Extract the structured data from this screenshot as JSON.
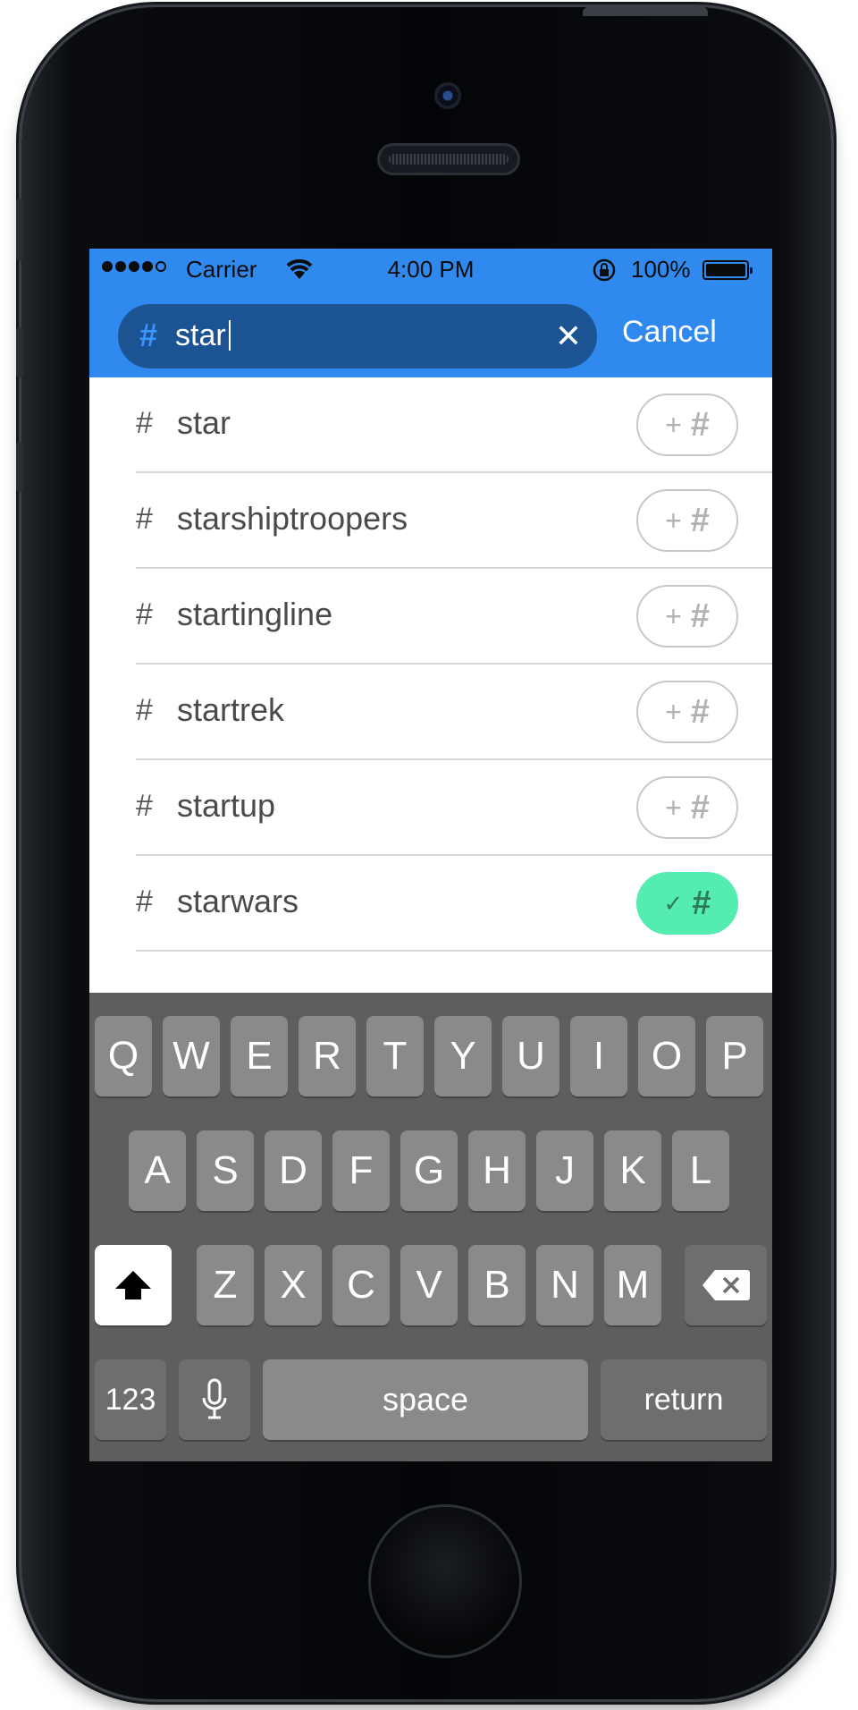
{
  "status_bar": {
    "carrier": "Carrier",
    "time": "4:00 PM",
    "battery": "100%"
  },
  "search": {
    "hash": "#",
    "value": "star",
    "clear": "✕",
    "cancel": "Cancel"
  },
  "results": [
    {
      "hash": "#",
      "label": "star",
      "selected": false,
      "icon": "plus",
      "tag": "#"
    },
    {
      "hash": "#",
      "label": "starshiptroopers",
      "selected": false,
      "icon": "plus",
      "tag": "#"
    },
    {
      "hash": "#",
      "label": "startingline",
      "selected": false,
      "icon": "plus",
      "tag": "#"
    },
    {
      "hash": "#",
      "label": "startrek",
      "selected": false,
      "icon": "plus",
      "tag": "#"
    },
    {
      "hash": "#",
      "label": "startup",
      "selected": false,
      "icon": "plus",
      "tag": "#"
    },
    {
      "hash": "#",
      "label": "starwars",
      "selected": true,
      "icon": "check",
      "tag": "#"
    }
  ],
  "keyboard": {
    "row1": [
      "Q",
      "W",
      "E",
      "R",
      "T",
      "Y",
      "U",
      "I",
      "O",
      "P"
    ],
    "row2": [
      "A",
      "S",
      "D",
      "F",
      "G",
      "H",
      "J",
      "K",
      "L"
    ],
    "row3": [
      "Z",
      "X",
      "C",
      "V",
      "B",
      "N",
      "M"
    ],
    "numbers": "123",
    "space": "space",
    "return": "return"
  },
  "colors": {
    "accent": "#2f89ee",
    "search_field": "#1c5493",
    "selected_tag": "#55ecb2",
    "keyboard_bg": "#5e5e5e"
  }
}
